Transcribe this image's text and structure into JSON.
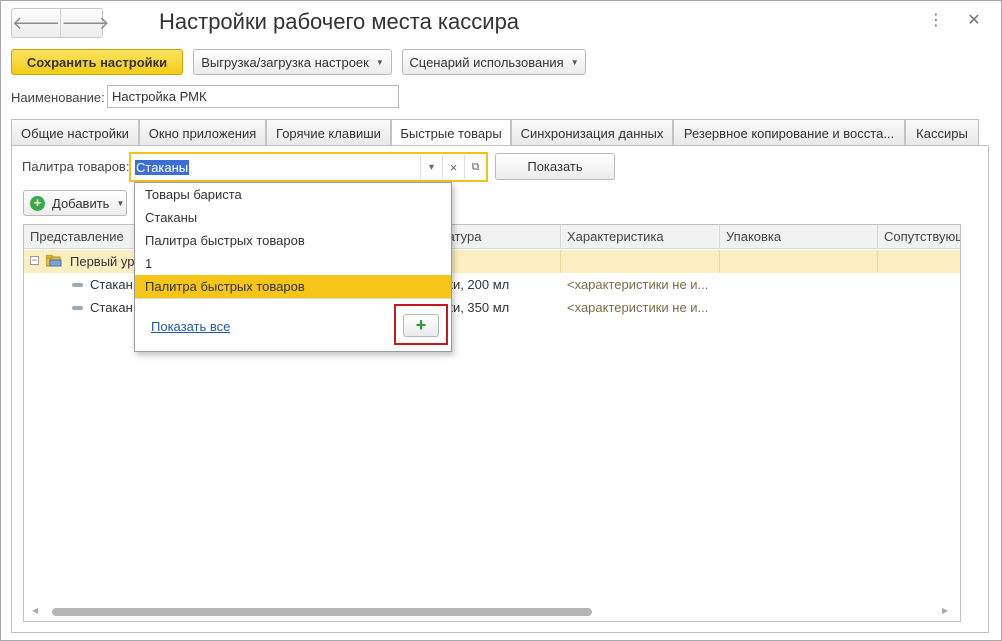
{
  "window": {
    "title": "Настройки рабочего места кассира",
    "back_glyph": "🡐",
    "forward_glyph": "🡒",
    "more_glyph": "⋮",
    "close_glyph": "✕"
  },
  "toolbar": {
    "save_label": "Сохранить настройки",
    "export_label": "Выгрузка/загрузка настроек",
    "scenario_label": "Сценарий использования"
  },
  "name_field": {
    "label": "Наименование:",
    "value": "Настройка РМК"
  },
  "tabs": [
    {
      "label": "Общие настройки"
    },
    {
      "label": "Окно приложения"
    },
    {
      "label": "Горячие клавиши"
    },
    {
      "label": "Быстрые товары",
      "active": true
    },
    {
      "label": "Синхронизация данных"
    },
    {
      "label": "Резервное копирование и восста..."
    },
    {
      "label": "Кассиры"
    }
  ],
  "palette": {
    "label": "Палитра товаров:",
    "value": "Стаканы",
    "show_button": "Показать",
    "dropdown_glyph": "▾",
    "clear_glyph": "×",
    "open_glyph": "⧉"
  },
  "add_button": {
    "label": "Добавить",
    "icon_glyph": "+"
  },
  "grid": {
    "columns": [
      "Представление",
      "Номенклатура",
      "Характеристика",
      "Упаковка",
      "Сопутствующ"
    ],
    "group_row": {
      "label": "Первый уровень"
    },
    "rows": [
      {
        "name": "Стакан",
        "nomenclature": "Стаканчики, 200 мл",
        "characteristic": "<характеристики не и..."
      },
      {
        "name": "Стакан",
        "nomenclature": "Стаканчики, 350 мл",
        "characteristic": "<характеристики не и..."
      }
    ],
    "visible_fragments": {
      "group_label": "Первый ур",
      "col_nomenclature": "латура",
      "row1_nomenclature": "ики, 200 мл",
      "row2_nomenclature": "ики, 350 мл"
    }
  },
  "dropdown": {
    "items": [
      {
        "label": "Товары бариста"
      },
      {
        "label": "Стаканы"
      },
      {
        "label": "Палитра быстрых товаров"
      },
      {
        "label": "1"
      },
      {
        "label": "Палитра быстрых товаров",
        "selected": true
      }
    ],
    "show_all_link": "Показать все",
    "add_glyph": "+"
  },
  "colors": {
    "accent_yellow": "#f5c518",
    "selection_blue": "#3b6fd6",
    "highlight_red": "#c41a1a",
    "add_green": "#2a9a3a",
    "group_row_bg": "#fbefc2"
  }
}
